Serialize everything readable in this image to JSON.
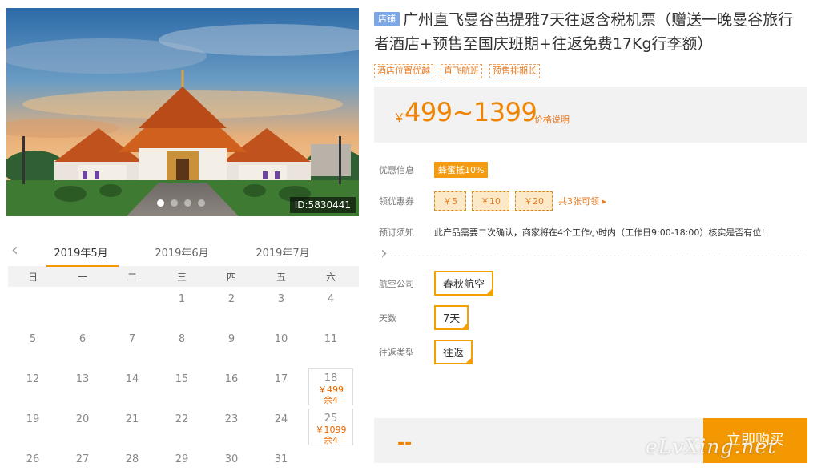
{
  "hero": {
    "id_label": "ID:5830441",
    "slides": 4,
    "active_slide": 0
  },
  "calendar": {
    "months": [
      "2019年5月",
      "2019年6月",
      "2019年7月"
    ],
    "active_month": "2019年5月",
    "weekdays": [
      "日",
      "一",
      "二",
      "三",
      "四",
      "五",
      "六"
    ],
    "leading_blanks": 3,
    "days": [
      {
        "d": "1"
      },
      {
        "d": "2"
      },
      {
        "d": "3"
      },
      {
        "d": "4"
      },
      {
        "d": "5"
      },
      {
        "d": "6"
      },
      {
        "d": "7"
      },
      {
        "d": "8"
      },
      {
        "d": "9"
      },
      {
        "d": "10"
      },
      {
        "d": "11"
      },
      {
        "d": "12"
      },
      {
        "d": "13"
      },
      {
        "d": "14"
      },
      {
        "d": "15"
      },
      {
        "d": "16"
      },
      {
        "d": "17"
      },
      {
        "d": "18",
        "price": "￥499",
        "stock": "余4"
      },
      {
        "d": "19"
      },
      {
        "d": "20"
      },
      {
        "d": "21"
      },
      {
        "d": "22"
      },
      {
        "d": "23"
      },
      {
        "d": "24"
      },
      {
        "d": "25",
        "price": "￥1099",
        "stock": "余4"
      },
      {
        "d": "26"
      },
      {
        "d": "27"
      },
      {
        "d": "28"
      },
      {
        "d": "29"
      },
      {
        "d": "30"
      },
      {
        "d": "31"
      }
    ]
  },
  "product": {
    "shop_badge": "店铺",
    "title": "广州直飞曼谷芭提雅7天往返含税机票（赠送一晚曼谷旅行者酒店+预售至国庆班期+往返免费17Kg行李额）",
    "tags": [
      "酒店位置优越",
      "直飞航班",
      "预售排期长"
    ]
  },
  "price": {
    "yen": "￥",
    "range": "499~1399",
    "note": "价格说明"
  },
  "info": {
    "promo_label": "优惠信息",
    "promo_badge": "蜂蜜抵10%",
    "coupon_label": "领优惠券",
    "coupons": [
      "￥5",
      "￥10",
      "￥20"
    ],
    "coupon_more": "共3张可领 ▸",
    "notice_label": "预订须知",
    "notice_text": "此产品需要二次确认，商家将在4个工作小时内（工作日9:00-18:00）核实是否有位!"
  },
  "options": [
    {
      "label": "航空公司",
      "value": "春秋航空"
    },
    {
      "label": "天数",
      "value": "7天"
    },
    {
      "label": "往返类型",
      "value": "往返"
    }
  ],
  "buy": {
    "total": "--",
    "button": "立即购买"
  },
  "watermark": "eLvXing.net",
  "colors": {
    "accent": "#f39800",
    "price": "#f08300",
    "badge_blue": "#7ca7e6"
  }
}
